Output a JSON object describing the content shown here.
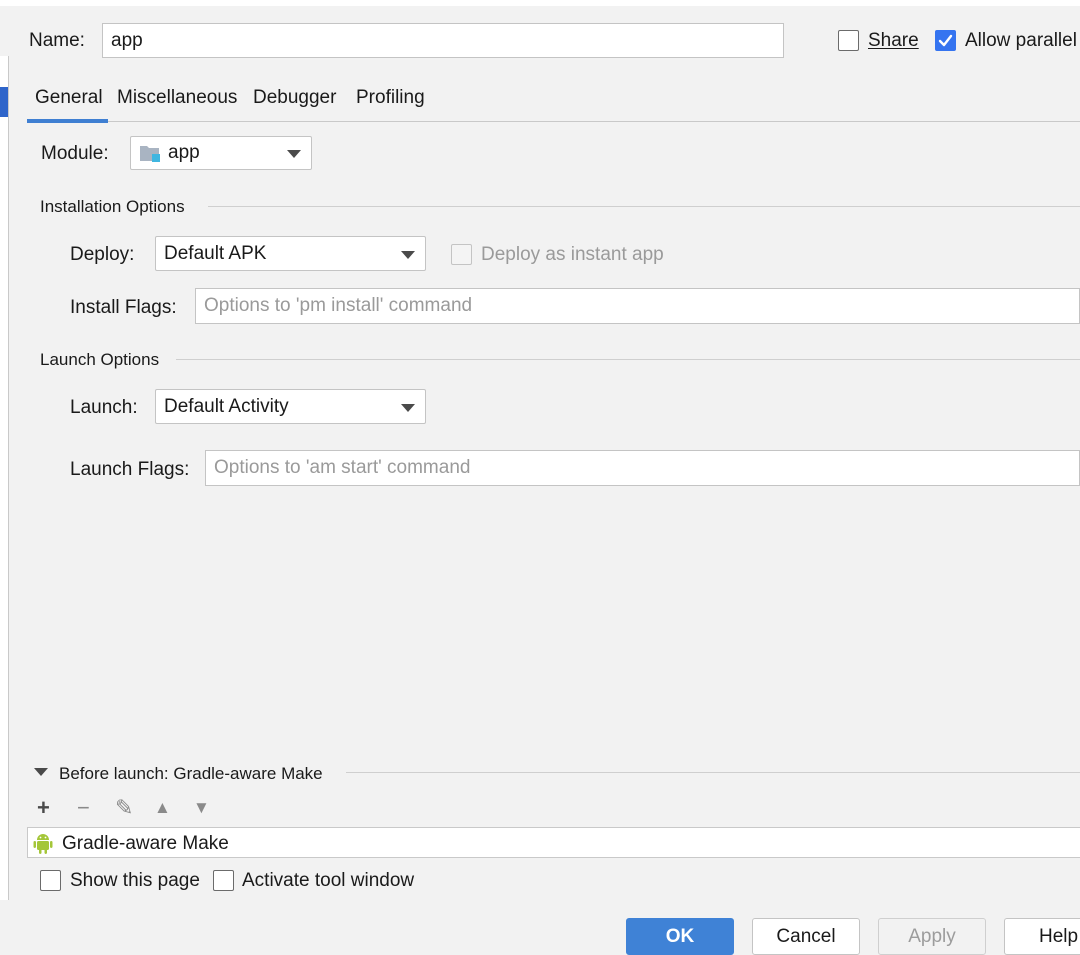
{
  "header": {
    "name_label": "Name:",
    "name_value": "app",
    "share_label": "Share",
    "share_checked": false,
    "allow_parallel_label": "Allow parallel",
    "allow_parallel_checked": true
  },
  "tabs": [
    {
      "label": "General",
      "selected": true
    },
    {
      "label": "Miscellaneous",
      "selected": false
    },
    {
      "label": "Debugger",
      "selected": false
    },
    {
      "label": "Profiling",
      "selected": false
    }
  ],
  "general": {
    "module_label": "Module:",
    "module_value": "app",
    "installation_title": "Installation Options",
    "deploy_label": "Deploy:",
    "deploy_value": "Default APK",
    "instant_app_label": "Deploy as instant app",
    "install_flags_label": "Install Flags:",
    "install_flags_placeholder": "Options to 'pm install' command",
    "launch_title": "Launch Options",
    "launch_label": "Launch:",
    "launch_value": "Default Activity",
    "launch_flags_label": "Launch Flags:",
    "launch_flags_placeholder": "Options to 'am start' command"
  },
  "before_launch": {
    "title": "Before launch: Gradle-aware Make",
    "toolbar": {
      "add": "+",
      "remove": "−",
      "edit": "✎",
      "up": "▲",
      "down": "▼"
    },
    "items": [
      "Gradle-aware Make"
    ],
    "show_page_label": "Show this page",
    "activate_tool_label": "Activate tool window"
  },
  "buttons": {
    "ok": "OK",
    "cancel": "Cancel",
    "apply": "Apply",
    "help": "Help"
  },
  "colors": {
    "accent": "#3f82d6",
    "android_green": "#a4c639"
  },
  "icons": {
    "module": "folder-module-icon",
    "android": "android-icon",
    "dropdown": "chevron-down-icon"
  }
}
